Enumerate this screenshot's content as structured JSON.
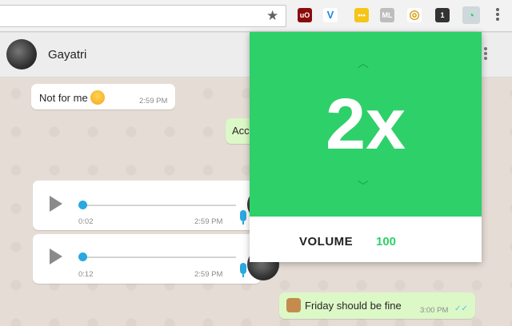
{
  "browser": {
    "star_icon": "★",
    "extensions": [
      {
        "name": "ublock",
        "label": "uO",
        "color": "#8b0b0b"
      },
      {
        "name": "vpn",
        "label": "V",
        "color": "#1e88e5"
      },
      {
        "name": "notes",
        "label": "•••",
        "color": "#f5c518"
      },
      {
        "name": "ml",
        "label": "ML",
        "color": "#bdbdbd"
      },
      {
        "name": "circle",
        "label": "◎",
        "color": "#d4a017"
      },
      {
        "name": "messages",
        "label": "1",
        "color": "#333333"
      },
      {
        "name": "speed-extension",
        "label": "◔",
        "color": "#2ed06a"
      }
    ]
  },
  "chat": {
    "contact_name": "Gayatri",
    "messages": {
      "m1": {
        "text": "Not for me",
        "time": "2:59 PM"
      },
      "m2": {
        "text": "Acc"
      },
      "v1": {
        "duration": "0:02",
        "time": "2:59 PM"
      },
      "v2": {
        "duration": "0:12",
        "time": "2:59 PM"
      },
      "m3": {
        "text": "Friday should be fine",
        "time": "3:00 PM",
        "ticks": "✓✓"
      }
    }
  },
  "popup": {
    "speed": "2x",
    "up_icon": "︿",
    "down_icon": "﹀",
    "volume_label": "VOLUME",
    "volume_value": "100",
    "accent": "#2ed06a"
  }
}
